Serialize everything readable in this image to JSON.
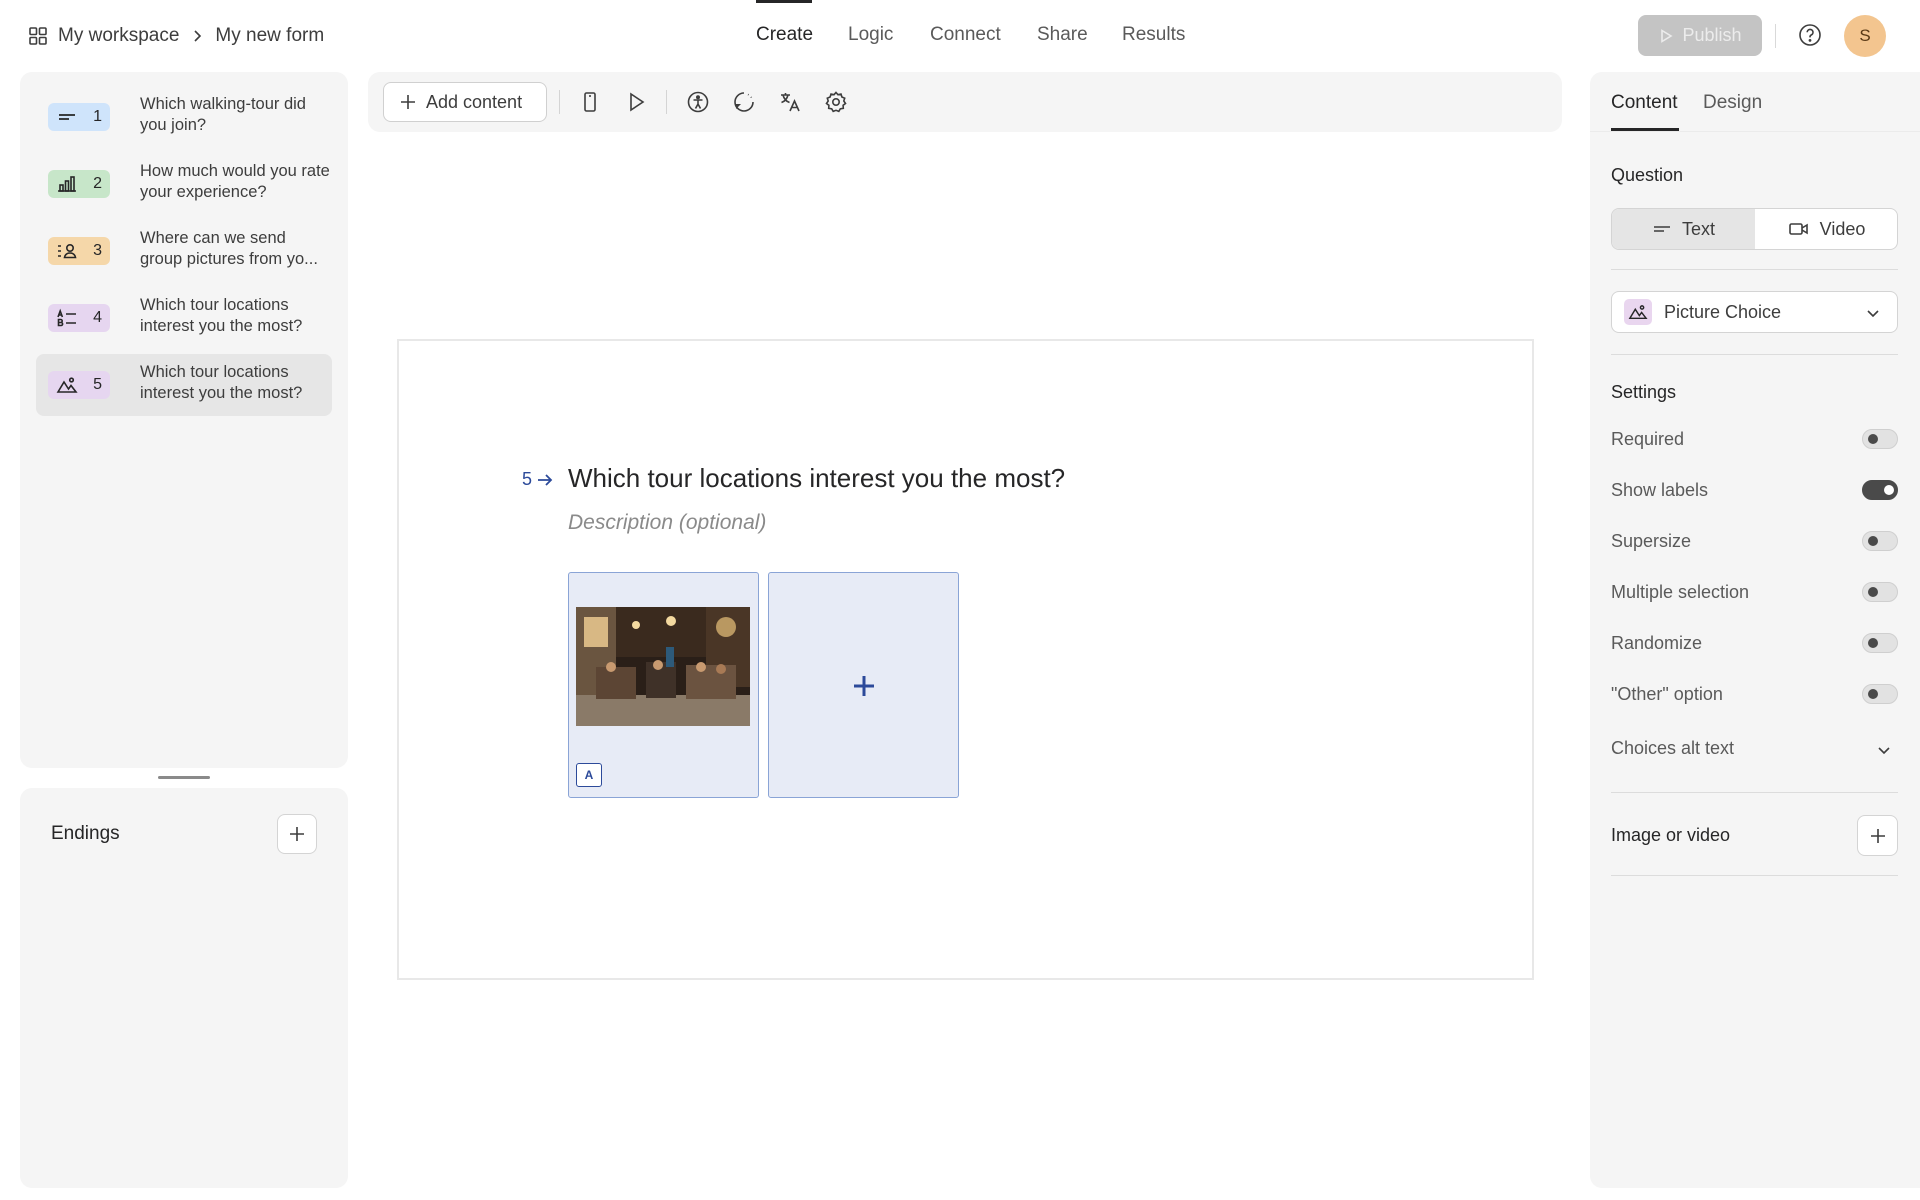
{
  "breadcrumb": {
    "workspace": "My workspace",
    "form": "My new form"
  },
  "nav": {
    "tabs": [
      "Create",
      "Logic",
      "Connect",
      "Share",
      "Results"
    ],
    "active": "Create"
  },
  "header": {
    "publish_label": "Publish",
    "avatar_initial": "S"
  },
  "questions": [
    {
      "number": "1",
      "title": "Which walking-tour did you join?",
      "icon": "short-text-icon",
      "color": "#cfe4fb"
    },
    {
      "number": "2",
      "title": "How much would you rate your experience?",
      "icon": "rating-bars-icon",
      "color": "#c7e6c9"
    },
    {
      "number": "3",
      "title": "Where can we send group pictures from yo...",
      "icon": "contact-info-icon",
      "color": "#f5d7a9"
    },
    {
      "number": "4",
      "title": "Which tour locations interest you the most?",
      "icon": "multiple-choice-icon",
      "color": "#e6d6f0"
    },
    {
      "number": "5",
      "title": "Which tour locations interest you the most?",
      "icon": "picture-choice-icon",
      "color": "#e6d6f0",
      "selected": true
    }
  ],
  "endings": {
    "label": "Endings"
  },
  "toolbar": {
    "add_content_label": "Add content"
  },
  "canvas": {
    "question_number": "5",
    "question_title": "Which tour locations interest you the most?",
    "description_placeholder": "Description (optional)",
    "choices": [
      {
        "key": "A",
        "image": "night-street-market-photo"
      }
    ]
  },
  "right_panel": {
    "tabs": [
      "Content",
      "Design"
    ],
    "active_tab": "Content",
    "question_label": "Question",
    "question_modes": [
      "Text",
      "Video"
    ],
    "active_mode": "Text",
    "question_type": "Picture Choice",
    "settings_label": "Settings",
    "settings": [
      {
        "label": "Required",
        "on": false
      },
      {
        "label": "Show labels",
        "on": true
      },
      {
        "label": "Supersize",
        "on": false
      },
      {
        "label": "Multiple selection",
        "on": false
      },
      {
        "label": "Randomize",
        "on": false
      },
      {
        "label": "\"Other\" option",
        "on": false
      }
    ],
    "choices_alt_text_label": "Choices alt text",
    "image_or_video_label": "Image or video"
  },
  "colors": {
    "accent": "#2c4a9a",
    "choice_bg": "#e7ebf6",
    "avatar": "#f3c58f"
  }
}
